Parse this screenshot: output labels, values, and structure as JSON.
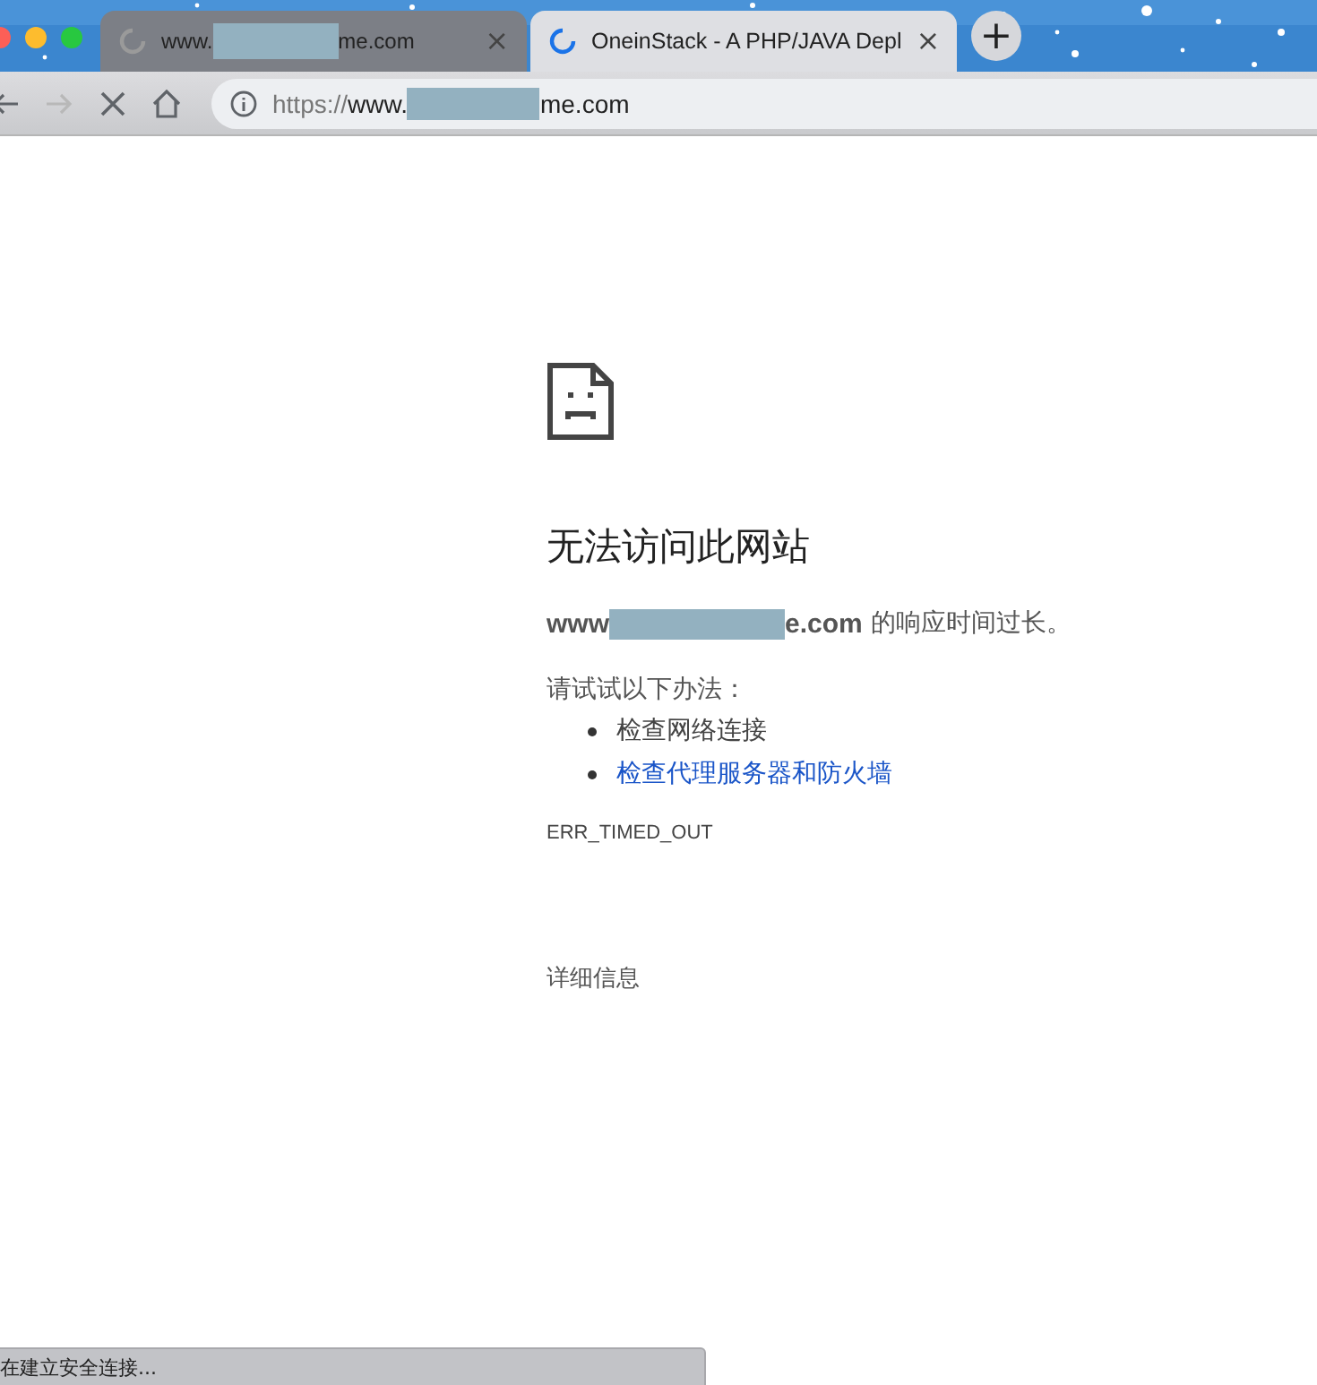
{
  "tabs": [
    {
      "title_prefix": "www.",
      "title_suffix": "me.com",
      "close": "×",
      "selected": false
    },
    {
      "title": "OneinStack - A PHP/JAVA Depl",
      "close": "×",
      "selected": true
    }
  ],
  "new_tab": "+",
  "toolbar": {
    "back_disabled": false,
    "forward_disabled": true
  },
  "address": {
    "scheme": "https://",
    "host_prefix": "www.",
    "host_suffix": "me.com"
  },
  "error": {
    "heading": "无法访问此网站",
    "host_prefix": "www",
    "host_suffix": "e.com",
    "message": " 的响应时间过长。",
    "suggest_title": "请试试以下办法：",
    "suggestions": [
      {
        "text": "检查网络连接",
        "kind": "plain"
      },
      {
        "text": "检查代理服务器和防火墙",
        "kind": "link"
      }
    ],
    "code": "ERR_TIMED_OUT",
    "details": "详细信息"
  },
  "status_bar": "在建立安全连接..."
}
